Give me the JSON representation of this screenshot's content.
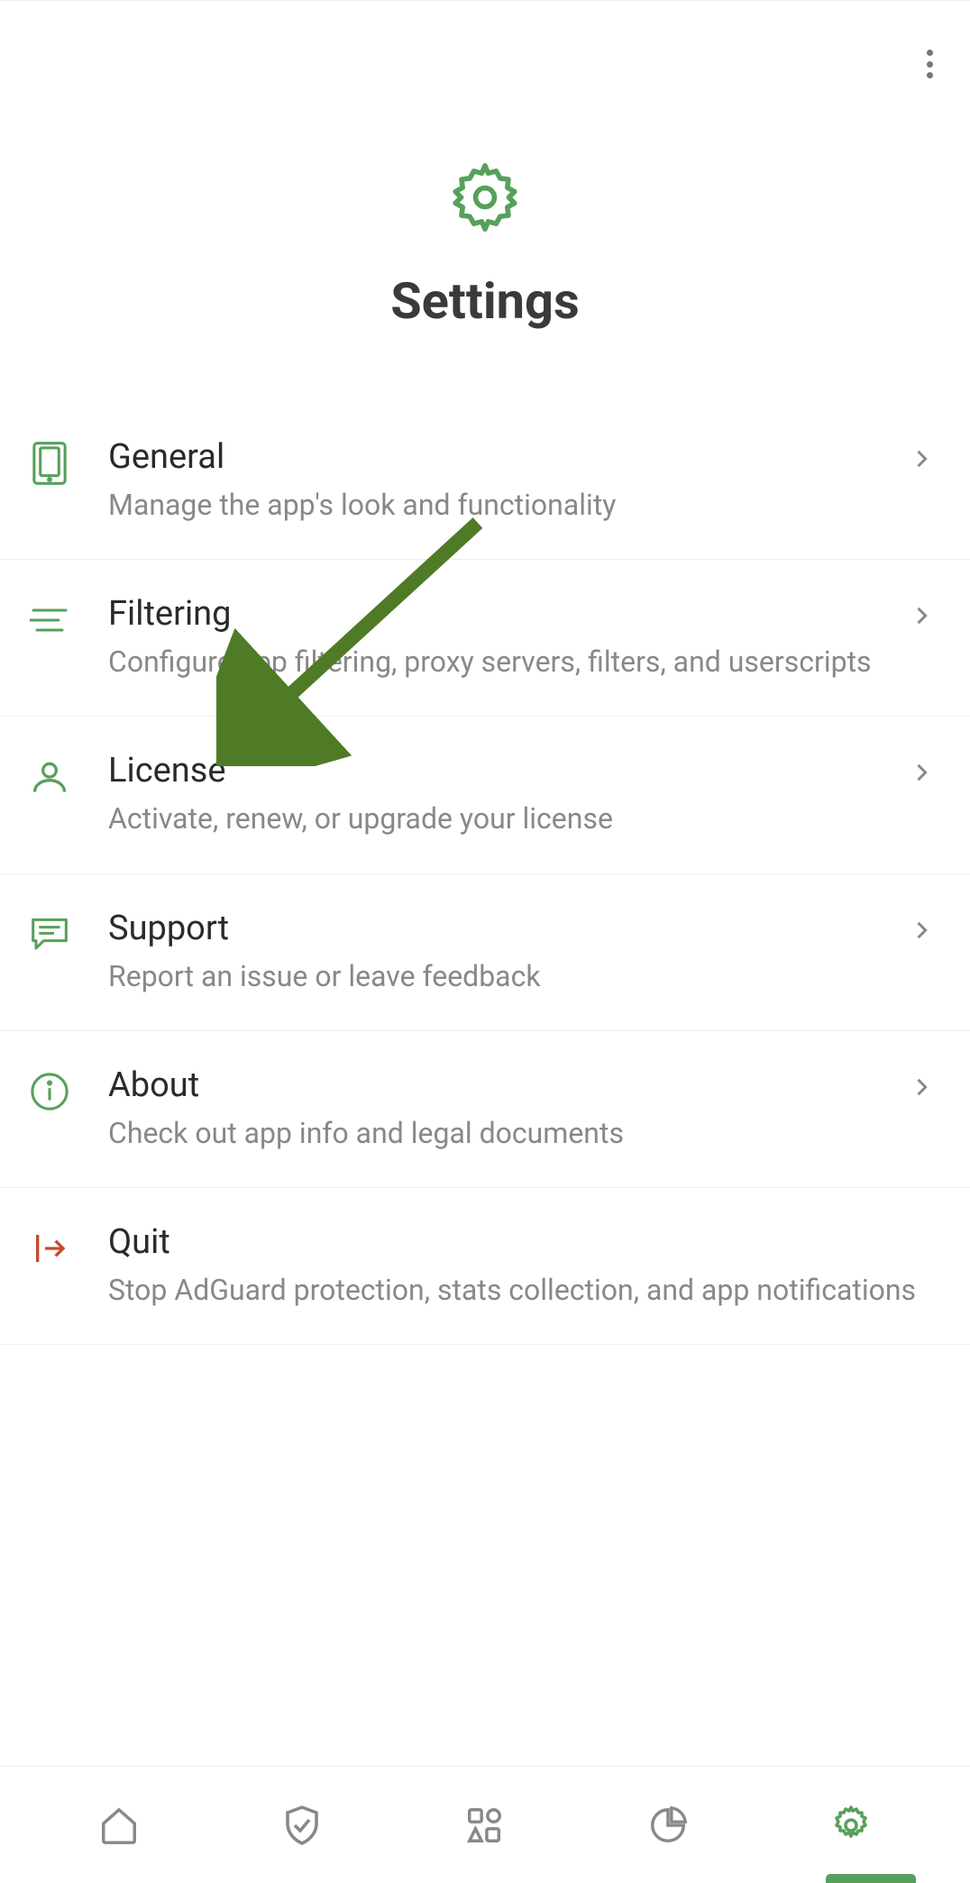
{
  "header": {
    "title": "Settings"
  },
  "items": [
    {
      "title": "General",
      "sub": "Manage the app's look and functionality"
    },
    {
      "title": "Filtering",
      "sub": "Configure app filtering, proxy servers, filters, and userscripts"
    },
    {
      "title": "License",
      "sub": "Activate, renew, or upgrade your license"
    },
    {
      "title": "Support",
      "sub": "Report an issue or leave feedback"
    },
    {
      "title": "About",
      "sub": "Check out app info and legal documents"
    },
    {
      "title": "Quit",
      "sub": "Stop AdGuard protection, stats collection, and app notifications"
    }
  ],
  "colors": {
    "accent": "#6fa85f",
    "accent2": "#57a05b",
    "danger": "#c0392b",
    "grey": "#888"
  }
}
